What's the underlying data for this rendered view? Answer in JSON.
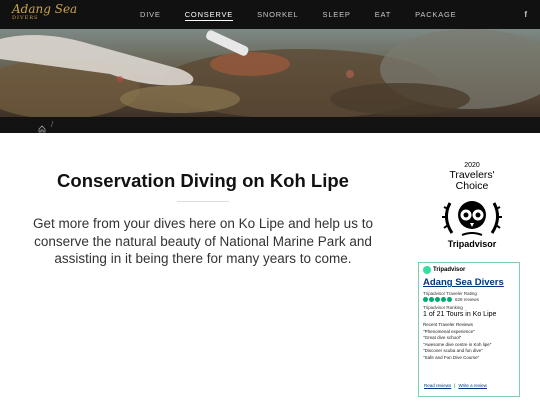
{
  "header": {
    "logo_text": "Adang Sea",
    "logo_subtitle": "DIVERS",
    "nav": [
      {
        "label": "DIVE",
        "active": false
      },
      {
        "label": "CONSERVE",
        "active": true
      },
      {
        "label": "SNORKEL",
        "active": false
      },
      {
        "label": "SLEEP",
        "active": false
      },
      {
        "label": "EAT",
        "active": false
      },
      {
        "label": "PACKAGE",
        "active": false
      }
    ],
    "social_icon": "facebook-icon",
    "social_glyph": "f"
  },
  "breadcrumb": {
    "home_icon": "home-icon",
    "separator": "/"
  },
  "main": {
    "title": "Conservation Diving on Koh Lipe",
    "intro": "Get more from your dives here on Ko Lipe and help us to conserve the natural beauty of National Marine Park and assisting in it being there for many years to come."
  },
  "award": {
    "year": "2020",
    "line1": "Travelers'",
    "line2": "Choice",
    "brand": "Tripadvisor"
  },
  "widget": {
    "header": "Tripadvisor",
    "business_name": "Adang Sea Divers",
    "rating_label": "Tripadvisor Traveler Rating",
    "rating_bubbles": 5,
    "review_count": "628 reviews",
    "ranking_label": "Tripadvisor Ranking",
    "ranking": "1 of 21 Tours in Ko Lipe",
    "recent_label": "Recent Traveler Reviews",
    "reviews": [
      "\"Phenomenal experience\"",
      "\"Great dive school\"",
      "\"Awesome dive centre in Koh lipe\"",
      "\"Discover scuba and fun dive\"",
      "\"Safe and Fun Dive Course\""
    ],
    "link_read": "Read reviews",
    "link_separator": "|",
    "link_write": "Write a review"
  },
  "colors": {
    "topbar": "#111111",
    "accent_gold": "#c9a24a",
    "tripadvisor_green": "#00aa6c"
  }
}
